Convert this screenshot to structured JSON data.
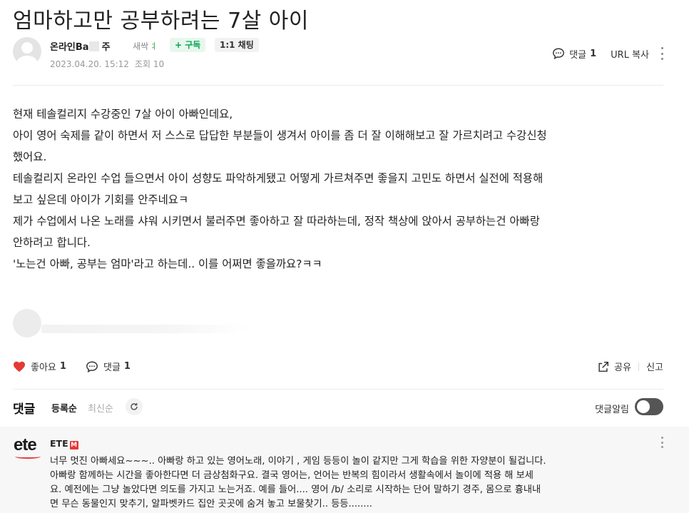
{
  "post": {
    "title": "엄마하고만 공부하려는 7살 아이",
    "author_name": "온라인Ba",
    "author_suffix": "주",
    "grade": "새싹",
    "subscribe_label": "+ 구독",
    "chat_label": "1:1 채팅",
    "date": "2023.04.20. 15:12",
    "views": "조회 10",
    "comment_label": "댓글",
    "comment_count": "1",
    "url_copy_label": "URL 복사",
    "body": [
      "현재 테솔컬리지 수강중인 7살 아이 아빠인데요,",
      "아이 영어 숙제를 같이 하면서 저 스스로 답답한 부분들이 생겨서 아이를 좀 더 잘 이해해보고 잘 가르치려고 수강신청",
      "했어요.",
      "테솔컬리지 온라인 수업 들으면서 아이 성향도 파악하게됐고 어떻게 가르쳐주면 좋을지 고민도 하면서 실전에 적용해",
      "보고 싶은데 아이가 기회를 안주네요ㅋ",
      "제가 수업에서 나온 노래를 샤워 시키면서 불러주면 좋아하고 잘 따라하는데, 정작 책상에 앉아서 공부하는건 아빠랑",
      "안하려고 합니다.",
      "'노는건 아빠, 공부는 엄마'라고 하는데.. 이를 어쩌면 좋을까요?ㅋㅋ"
    ]
  },
  "actions": {
    "like_label": "좋아요",
    "like_count": "1",
    "comment_label": "댓글",
    "comment_count": "1",
    "share_label": "공유",
    "report_label": "신고"
  },
  "comments_section": {
    "heading": "댓글",
    "sort_registered": "등록순",
    "sort_latest": "최신순",
    "notify_label": "댓글알림",
    "notify_on": false
  },
  "comment": {
    "logo_text": "ete",
    "author": "ETE",
    "badge": "M",
    "lines": [
      "너무 멋진 아빠세요~~~.. 아빠랑 하고 있는 영어노래, 이야기 , 게임 등등이 놀이 같지만 그게 학습을 위한 자양분이 될겁니다.",
      "아빠랑 함께하는 시간을 좋아한다면 더 금상첨화구요. 결국 영어는, 언어는 반복의 힘이라서 생활속에서 놀이에 적용 해 보세",
      "요. 예전에는 그냥 놀았다면 의도를 가지고 노는거죠. 예를 들어.... 영어 /b/ 소리로 시작하는 단어 말하기 경주, 몸으로 흉내내",
      "면 무슨 동물인지 맞추기, 알파벳카드 집안 곳곳에 숨겨 놓고 보물찾기.. 등등........"
    ]
  },
  "colors": {
    "accent_green": "#03a74e",
    "heart_red": "#e53935",
    "toggle_off": "#555555"
  }
}
